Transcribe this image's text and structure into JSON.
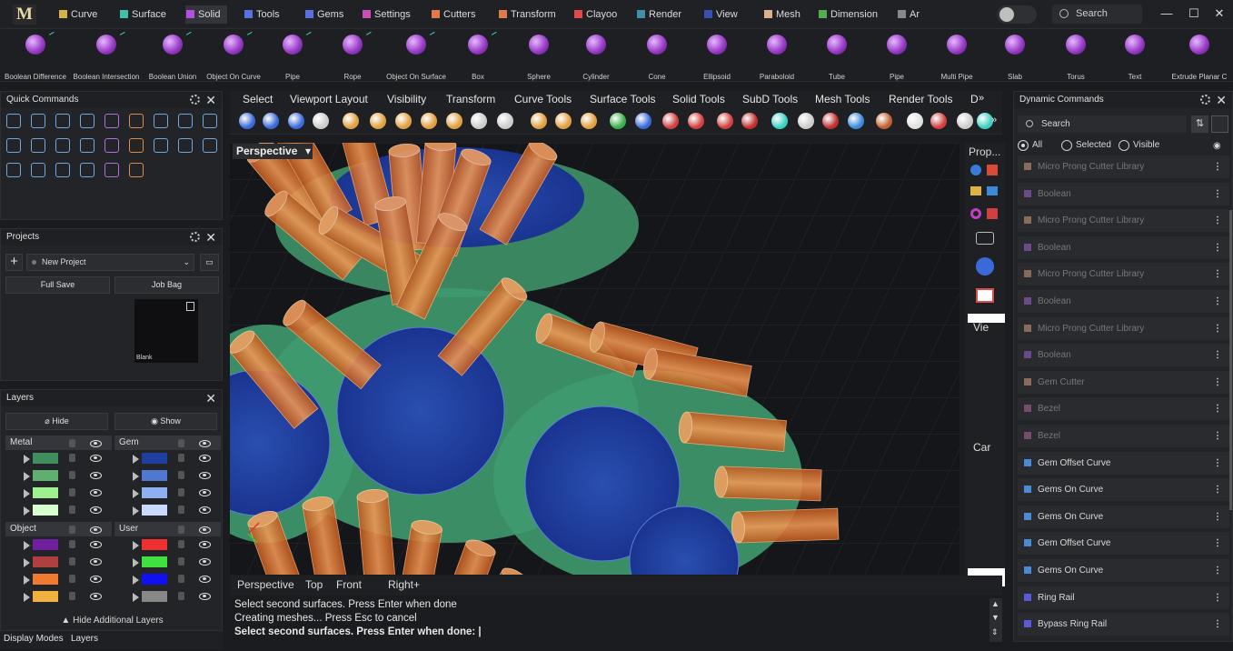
{
  "app": {
    "logo": "M"
  },
  "menu_tabs": [
    {
      "label": "Curve",
      "color": "#d4b24a"
    },
    {
      "label": "Surface",
      "color": "#3fbfa3"
    },
    {
      "label": "Solid",
      "color": "#b44fe0",
      "active": true
    },
    {
      "label": "Tools",
      "color": "#5a6fe0"
    },
    {
      "label": "Gems",
      "color": "#5a6fe0"
    },
    {
      "label": "Settings",
      "color": "#c84fb8"
    },
    {
      "label": "Cutters",
      "color": "#e07a4a"
    },
    {
      "label": "Transform",
      "color": "#e07a4a"
    },
    {
      "label": "Clayoo",
      "color": "#e04a4a"
    },
    {
      "label": "Render",
      "color": "#3f8fa8"
    },
    {
      "label": "View",
      "color": "#3a4fb0"
    },
    {
      "label": "Mesh",
      "color": "#d9b08a"
    },
    {
      "label": "Dimension",
      "color": "#4fb04f"
    },
    {
      "label": "Ar",
      "color": "#888888"
    }
  ],
  "search": {
    "label": "Search"
  },
  "window_controls": {
    "minimize": "—",
    "maximize": "☐",
    "close": "✕"
  },
  "ribbon_tools": [
    "Boolean Difference",
    "Boolean Intersection",
    "Boolean Union",
    "Object On Curve",
    "Pipe",
    "Rope",
    "Object On Surface",
    "Box",
    "Sphere",
    "Cylinder",
    "Cone",
    "Ellipsoid",
    "Paraboloid",
    "Tube",
    "Pipe",
    "Multi Pipe",
    "Slab",
    "Torus",
    "Text",
    "Extrude Planar C"
  ],
  "quick_commands": {
    "title": "Quick Commands"
  },
  "projects": {
    "title": "Projects",
    "project_name": "New Project",
    "full_save": "Full Save",
    "job_bag": "Job Bag",
    "thumb_label": "Blank"
  },
  "layers": {
    "title": "Layers",
    "hide": "Hide",
    "show": "Show",
    "groups": [
      {
        "name": "Metal",
        "swatches": [
          "#3f8f5f",
          "#5fb070",
          "#9ff08f",
          "#d8ffd0"
        ]
      },
      {
        "name": "Gem",
        "swatches": [
          "#1f3f9f",
          "#4f78d0",
          "#8fb0f0",
          "#c8d8ff"
        ]
      },
      {
        "name": "Object",
        "swatches": [
          "#6f1fa0",
          "#b04040",
          "#f07a30",
          "#f0b040"
        ]
      },
      {
        "name": "User",
        "swatches": [
          "#f03030",
          "#3fe03f",
          "#1010f0",
          "#888888"
        ]
      }
    ],
    "hide_additional": "Hide Additional Layers"
  },
  "viewport_tabs": [
    "Select",
    "Viewport Layout",
    "Visibility",
    "Transform",
    "Curve Tools",
    "Surface Tools",
    "Solid Tools",
    "SubD Tools",
    "Mesh Tools",
    "Render Tools",
    "D"
  ],
  "viewport": {
    "label": "Perspective"
  },
  "properties": {
    "title": "Prop...",
    "side1": "Vie",
    "side2": "Car"
  },
  "bottom_view_tabs": [
    "Perspective",
    "Top",
    "Front",
    "Right",
    "+"
  ],
  "command_line": [
    "Select second surfaces. Press Enter when done",
    "Creating meshes... Press Esc to cancel",
    "Select second surfaces. Press Enter when done: |"
  ],
  "dynamic_commands": {
    "title": "Dynamic Commands",
    "search": "Search",
    "filters": [
      "All",
      "Selected",
      "Visible"
    ],
    "items": [
      {
        "label": "Micro Prong Cutter Library",
        "color": "#8a6a5a",
        "dim": true
      },
      {
        "label": "Boolean",
        "color": "#6a4a8a",
        "dim": true
      },
      {
        "label": "Micro Prong Cutter Library",
        "color": "#8a6a5a",
        "dim": true
      },
      {
        "label": "Boolean",
        "color": "#6a4a8a",
        "dim": true
      },
      {
        "label": "Micro Prong Cutter Library",
        "color": "#8a6a5a",
        "dim": true
      },
      {
        "label": "Boolean",
        "color": "#6a4a8a",
        "dim": true
      },
      {
        "label": "Micro Prong Cutter Library",
        "color": "#8a6a5a",
        "dim": true
      },
      {
        "label": "Boolean",
        "color": "#6a4a8a",
        "dim": true
      },
      {
        "label": "Gem Cutter",
        "color": "#8a6a5a",
        "dim": true
      },
      {
        "label": "Bezel",
        "color": "#7a4a6a",
        "dim": true
      },
      {
        "label": "Bezel",
        "color": "#7a4a6a",
        "dim": true
      },
      {
        "label": "Gem Offset Curve",
        "color": "#4a8ad8",
        "dim": false
      },
      {
        "label": "Gems On Curve",
        "color": "#4a8ad8",
        "dim": false
      },
      {
        "label": "Gems On Curve",
        "color": "#4a8ad8",
        "dim": false
      },
      {
        "label": "Gem Offset Curve",
        "color": "#4a8ad8",
        "dim": false
      },
      {
        "label": "Gems On Curve",
        "color": "#4a8ad8",
        "dim": false
      },
      {
        "label": "Ring Rail",
        "color": "#5a5ad8",
        "dim": false
      },
      {
        "label": "Bypass Ring Rail",
        "color": "#5a5ad8",
        "dim": false
      }
    ]
  },
  "status_tabs": [
    "Display Modes",
    "Layers"
  ]
}
